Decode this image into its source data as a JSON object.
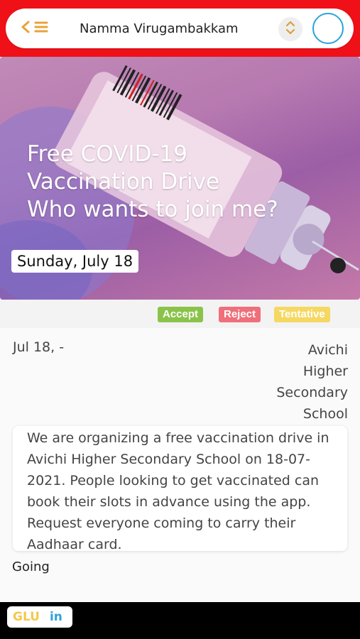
{
  "header": {
    "title": "Namma Virugambakkam",
    "back_icon": "chevron-left-icon",
    "menu_icon": "hamburger-menu-icon",
    "sort_icon": "up-down-chevron-icon",
    "accent_color": "#f01018",
    "avatar_ring_color": "#2aa3d8"
  },
  "event": {
    "title_lines": [
      "Free COVID-19",
      "Vaccination Drive",
      "Who wants to join me?"
    ],
    "date_badge": "Sunday, July 18",
    "when": "Jul 18, -",
    "where_lines": [
      "Avichi",
      "Higher",
      "Secondary",
      "School"
    ],
    "description": "We are organizing a free vaccination drive in Avichi Higher Secondary School on 18-07-2021. People looking to get vaccinated can book their slots in advance using the app. Request everyone coming to carry their Aadhaar card.",
    "status": "Going"
  },
  "rsvp": {
    "accept": "Accept",
    "reject": "Reject",
    "tentative": "Tentative",
    "accept_color": "#8bc34a",
    "reject_color": "#ef6f7a",
    "tentative_color": "#f5d862"
  },
  "footer": {
    "button_part1": "GLU",
    "button_part2": "in"
  }
}
